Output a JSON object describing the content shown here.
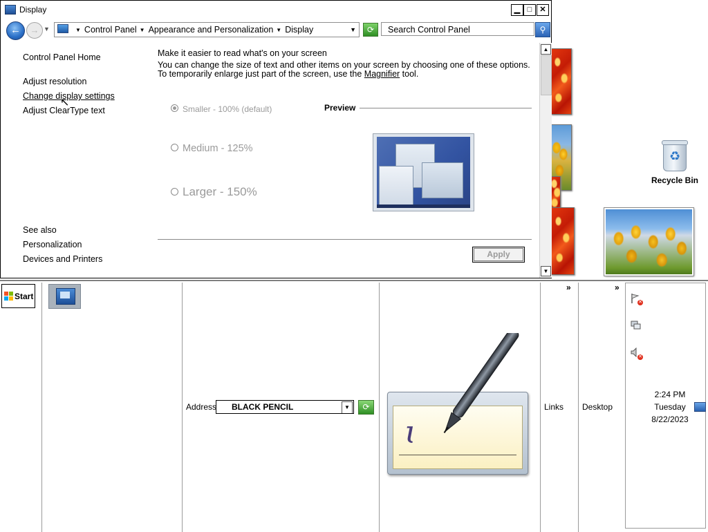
{
  "window": {
    "title": "Display",
    "controls": {
      "minimize": "▁",
      "maximize": "□",
      "close": "✕"
    }
  },
  "address_bar": {
    "back_icon": "back-arrow-icon",
    "forward_icon": "forward-arrow-icon",
    "breadcrumb": [
      "Control Panel",
      "Appearance and Personalization",
      "Display"
    ],
    "search_placeholder": "Search Control Panel"
  },
  "left_pane": {
    "home": "Control Panel Home",
    "tasks": [
      "Adjust resolution",
      "Change display settings",
      "Adjust ClearType text"
    ],
    "see_also_heading": "See also",
    "see_also": [
      "Personalization",
      "Devices and Printers"
    ]
  },
  "main": {
    "heading": "Make it easier to read what's on your screen",
    "description_part1": "You can change the size of text and other items on your screen by choosing one of these options. To temporarily enlarge just part of the screen, use the ",
    "description_link": "Magnifier",
    "description_part2": " tool.",
    "options": [
      {
        "label": "Smaller - 100% (default)",
        "selected": true
      },
      {
        "label": "Medium - 125%",
        "selected": false
      },
      {
        "label": "Larger - 150%",
        "selected": false
      }
    ],
    "preview_label": "Preview",
    "apply_label": "Apply"
  },
  "desktop": {
    "recycle_bin_label": "Recycle Bin"
  },
  "taskbar": {
    "start_label": "Start",
    "address_label": "Address",
    "address_value": "BLACK PENCIL",
    "links_label": "Links",
    "desktop_label": "Desktop",
    "chevron": "»",
    "clock": {
      "time": "2:24 PM",
      "day": "Tuesday",
      "date": "8/22/2023"
    }
  },
  "colors": {
    "accent_blue": "#2a6fc7",
    "go_green": "#2f8f24",
    "disabled_text": "#9a9a9a"
  }
}
